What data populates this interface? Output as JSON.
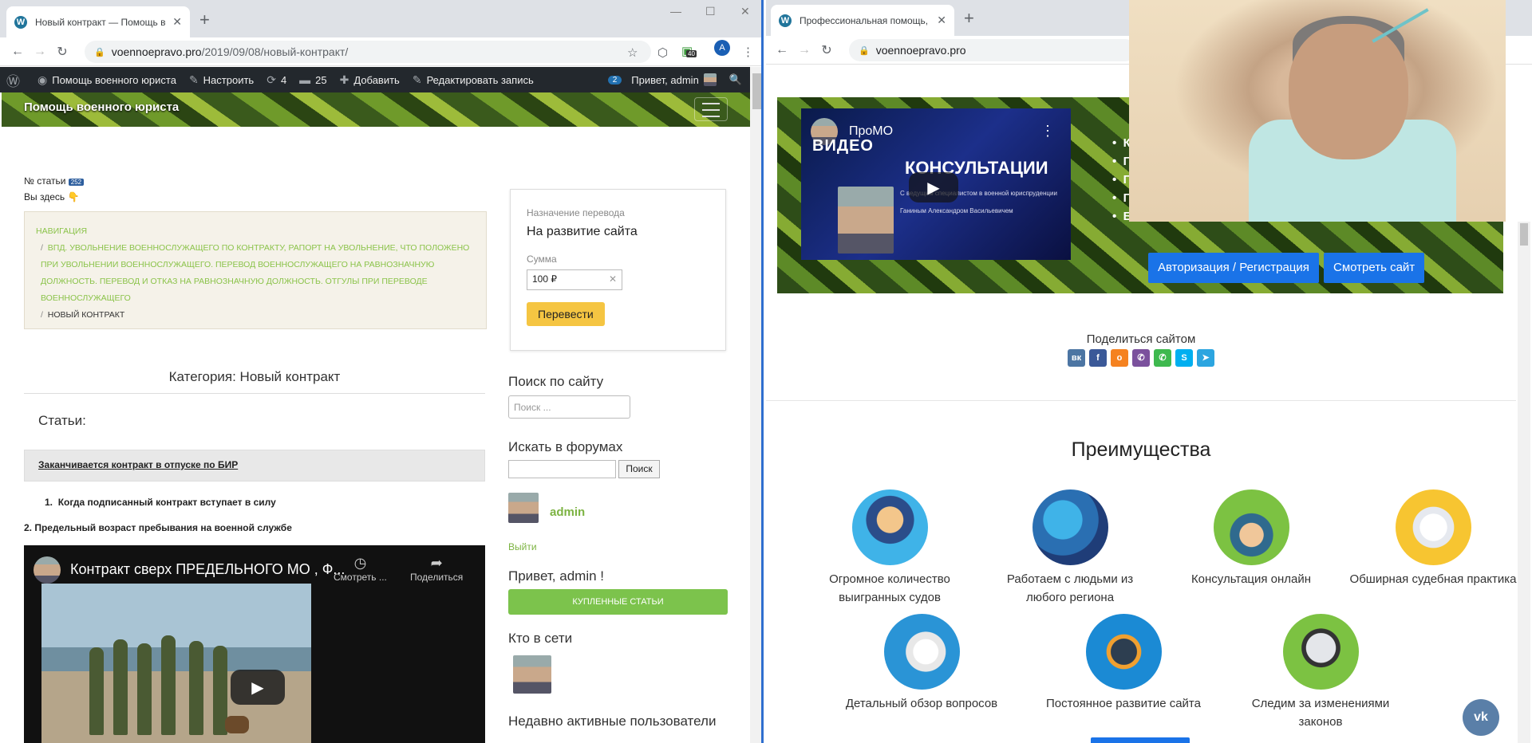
{
  "left": {
    "tab_title": "Новый контракт — Помощь во",
    "url_domain": "voennoepravo.pro",
    "url_path": "/2019/09/08/новый-контракт/",
    "ext_badge": "40",
    "profile_letter": "A",
    "adminbar": {
      "site": "Помощь военного юриста",
      "customize": "Настроить",
      "updates": "4",
      "comments": "25",
      "add": "Добавить",
      "edit": "Редактировать запись",
      "notif": "2",
      "hello": "Привет, admin"
    },
    "site_title": "Помощь военного юриста",
    "article_no_label": "№ статьи",
    "article_no": "252",
    "you_are_here": "Вы здесь 👇",
    "breadcrumb": {
      "nav": "Навигация",
      "parent": "ВПД. Увольнение военнослужащего по контракту, рапорт на увольнение, что положено при увольнении военнослужащего. Перевод военнослужащего на равнозначную должность. Перевод и отказ на равнозначную должность. Отгулы при переводе военнослужащего",
      "current": "Новый контракт"
    },
    "donate": {
      "purpose_label": "Назначение перевода",
      "purpose": "На развитие сайта",
      "sum_label": "Сумма",
      "sum": "100 ₽",
      "button": "Перевести"
    },
    "category": "Категория: Новый контракт",
    "articles_heading": "Статьи:",
    "article_link": "Заканчивается контракт в отпуске по БИР",
    "list_item_1": "Когда подписанный контракт вступает в силу",
    "list_item_2": "2. Предельный возраст пребывания на военной службе",
    "video": {
      "title": "Контракт сверх ПРЕДЕЛЬНОГО МО , Ф...",
      "watch": "Смотреть ...",
      "share": "Поделиться"
    },
    "sidebar": {
      "search_heading": "Поиск по сайту",
      "search_placeholder": "Поиск ...",
      "forum_heading": "Искать в форумах",
      "forum_button": "Поиск",
      "user": "admin",
      "logout": "Выйти",
      "hello": "Привет, admin !",
      "purchased": "КУПЛЕННЫЕ СТАТЬИ",
      "online": "Кто в сети",
      "recent": "Недавно активные пользователи"
    }
  },
  "right": {
    "tab_title": "Профессиональная помощь, во",
    "url_domain": "voennoepravo.pro",
    "promo": {
      "channel": "ПроМО",
      "line1": "ВИДЕО",
      "line2": "КОНСУЛЬТАЦИИ",
      "line3": "С ведущим специалистом в военной юриспруденции",
      "line4": "Ганиным Александром Васильевичем"
    },
    "bullets": [
      "К",
      "Г",
      "Г",
      "Г",
      "Б"
    ],
    "auth_button": "Авторизация / Регистрация",
    "view_button": "Смотреть сайт",
    "share_label": "Поделиться сайтом",
    "advantages_title": "Преимущества",
    "features": [
      "Огромное количество выигранных судов",
      "Работаем с людьми из любого региона",
      "Консультация онлайн",
      "Обширная судебная практика",
      "Детальный обзор вопросов",
      "Постоянное развитие сайта",
      "Следим за изменениями законов"
    ]
  }
}
